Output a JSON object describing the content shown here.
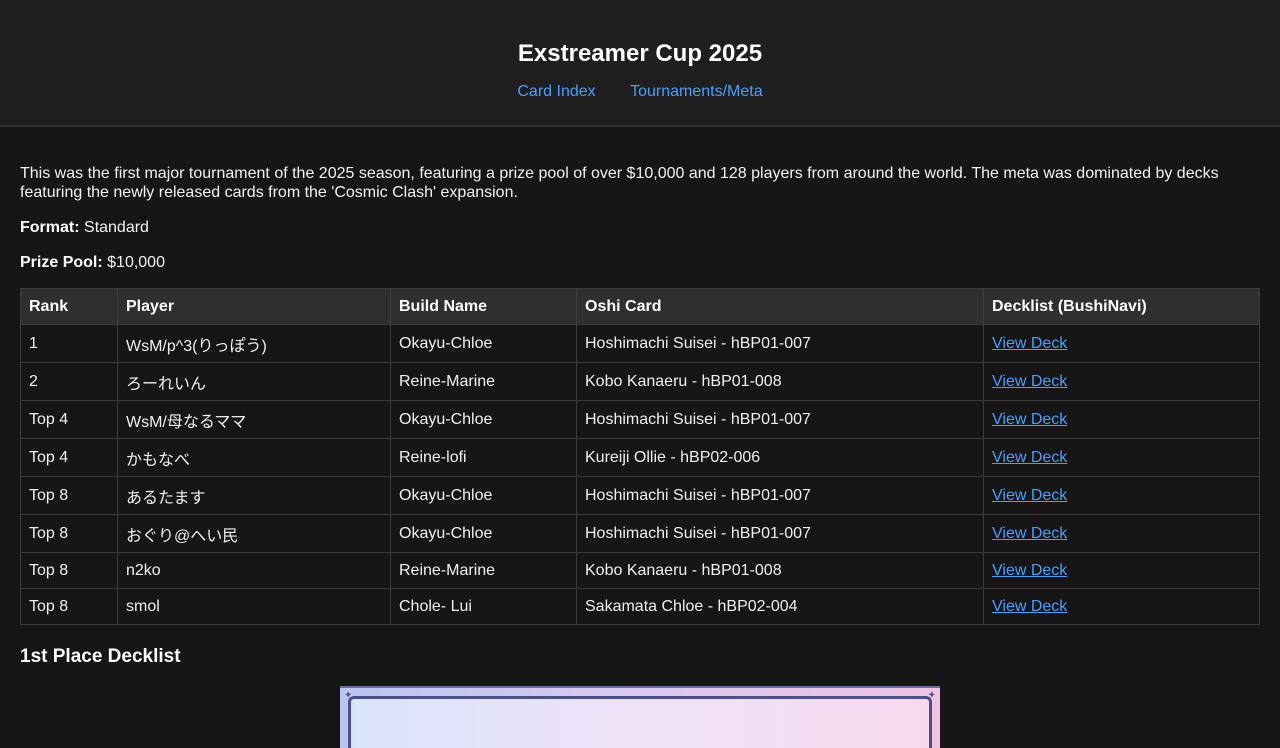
{
  "header": {
    "title": "Exstreamer Cup 2025",
    "nav": {
      "card_index": "Card Index",
      "tournaments_meta": "Tournaments/Meta"
    }
  },
  "main": {
    "intro": "This was the first major tournament of the 2025 season, featuring a prize pool of over $10,000 and 128 players from around the world. The meta was dominated by decks featuring the newly released cards from the 'Cosmic Clash' expansion.",
    "format_label": "Format:",
    "format_value": "Standard",
    "prize_label": "Prize Pool:",
    "prize_value": "$10,000",
    "table": {
      "headers": [
        "Rank",
        "Player",
        "Build Name",
        "Oshi Card",
        "Decklist (BushiNavi)"
      ],
      "rows": [
        {
          "rank": "1",
          "player": "WsM/p^3(りっぽう)",
          "build": "Okayu-Chloe",
          "oshi": "Hoshimachi Suisei - hBP01-007",
          "deck": "View Deck"
        },
        {
          "rank": "2",
          "player": "ろーれいん",
          "build": "Reine-Marine",
          "oshi": "Kobo Kanaeru - hBP01-008",
          "deck": "View Deck"
        },
        {
          "rank": "Top 4",
          "player": "WsM/母なるママ",
          "build": "Okayu-Chloe",
          "oshi": "Hoshimachi Suisei - hBP01-007",
          "deck": "View Deck"
        },
        {
          "rank": "Top 4",
          "player": "かもなべ",
          "build": "Reine-lofi",
          "oshi": "Kureiji Ollie - hBP02-006",
          "deck": "View Deck"
        },
        {
          "rank": "Top 8",
          "player": "あるたます",
          "build": "Okayu-Chloe",
          "oshi": "Hoshimachi Suisei - hBP01-007",
          "deck": "View Deck"
        },
        {
          "rank": "Top 8",
          "player": "おぐり@へい民",
          "build": "Okayu-Chloe",
          "oshi": "Hoshimachi Suisei - hBP01-007",
          "deck": "View Deck"
        },
        {
          "rank": "Top 8",
          "player": "n2ko",
          "build": "Reine-Marine",
          "oshi": "Kobo Kanaeru - hBP01-008",
          "deck": "View Deck"
        },
        {
          "rank": "Top 8",
          "player": "smol",
          "build": "Chole- Lui",
          "oshi": "Sakamata Chloe - hBP02-004",
          "deck": "View Deck"
        }
      ]
    },
    "decklist_heading": "1st Place Decklist"
  },
  "colors": {
    "background": "#161616",
    "header_bg": "#1f1f1f",
    "link": "#4a9eff",
    "table_header_bg": "#2f2f2f"
  }
}
